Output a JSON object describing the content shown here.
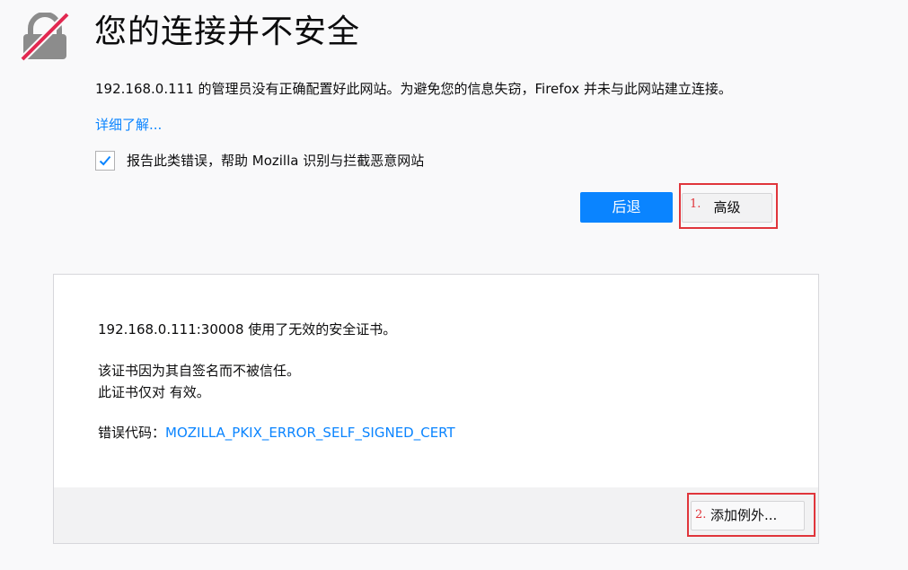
{
  "header": {
    "title": "您的连接并不安全",
    "icon": "broken-lock-icon"
  },
  "intro": {
    "description": "192.168.0.111 的管理员没有正确配置好此网站。为避免您的信息失窃，Firefox 并未与此网站建立连接。",
    "learn_more": "详细了解..."
  },
  "report": {
    "checked": true,
    "label": "报告此类错误，帮助 Mozilla 识别与拦截恶意网站"
  },
  "actions": {
    "back_label": "后退",
    "advanced_label": "高级",
    "step1_marker": "1."
  },
  "advanced": {
    "cert_invalid": "192.168.0.111:30008 使用了无效的安全证书。",
    "self_signed": "该证书因为其自签名而不被信任。",
    "valid_for": "此证书仅对  有效。",
    "error_code_prefix": "错误代码：",
    "error_code": "MOZILLA_PKIX_ERROR_SELF_SIGNED_CERT",
    "add_exception_label": "添加例外...",
    "step2_marker": "2."
  },
  "colors": {
    "accent": "#0a84ff",
    "annotation": "#e0353b",
    "background": "#f9f9fa"
  }
}
